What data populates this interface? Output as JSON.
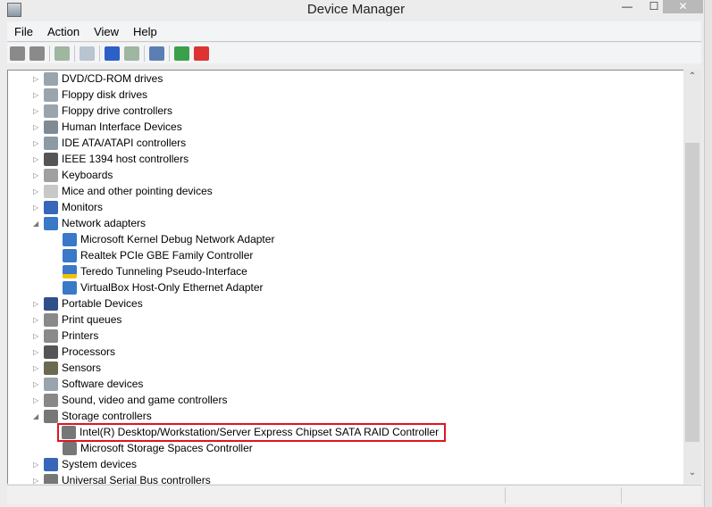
{
  "window": {
    "title": "Device Manager",
    "minimize": "—",
    "maximize": "☐",
    "close": "✕"
  },
  "menu": [
    "File",
    "Action",
    "View",
    "Help"
  ],
  "toolbar": [
    {
      "name": "back-icon",
      "color": "#8a8a8a"
    },
    {
      "name": "forward-icon",
      "color": "#8a8a8a"
    },
    {
      "sep": true
    },
    {
      "name": "show-hide-console-tree-icon",
      "color": "#9fb6a0"
    },
    {
      "sep": true
    },
    {
      "name": "properties-icon",
      "color": "#b8c4d0"
    },
    {
      "sep": true
    },
    {
      "name": "help-icon",
      "color": "#2d5fc8"
    },
    {
      "name": "show-action-pane-icon",
      "color": "#9fb6a0"
    },
    {
      "sep": true
    },
    {
      "name": "scan-hardware-icon",
      "color": "#5b7fb3"
    },
    {
      "sep": true
    },
    {
      "name": "update-driver-icon",
      "color": "#3aa04a"
    },
    {
      "name": "uninstall-icon",
      "color": "#d33"
    }
  ],
  "tree": [
    {
      "label": "DVD/CD-ROM drives",
      "level": 0,
      "state": "collapsed",
      "icon": "#9aa4ad"
    },
    {
      "label": "Floppy disk drives",
      "level": 0,
      "state": "collapsed",
      "icon": "#9aa4ad"
    },
    {
      "label": "Floppy drive controllers",
      "level": 0,
      "state": "collapsed",
      "icon": "#9aa4ad"
    },
    {
      "label": "Human Interface Devices",
      "level": 0,
      "state": "collapsed",
      "icon": "#7f8a94"
    },
    {
      "label": "IDE ATA/ATAPI controllers",
      "level": 0,
      "state": "collapsed",
      "icon": "#8c9aa3"
    },
    {
      "label": "IEEE 1394 host controllers",
      "level": 0,
      "state": "collapsed",
      "icon": "#555"
    },
    {
      "label": "Keyboards",
      "level": 0,
      "state": "collapsed",
      "icon": "#a0a0a0"
    },
    {
      "label": "Mice and other pointing devices",
      "level": 0,
      "state": "collapsed",
      "icon": "#c8c8c8"
    },
    {
      "label": "Monitors",
      "level": 0,
      "state": "collapsed",
      "icon": "#3866b8"
    },
    {
      "label": "Network adapters",
      "level": 0,
      "state": "expanded",
      "icon": "#3a78c8"
    },
    {
      "label": "Microsoft Kernel Debug Network Adapter",
      "level": 1,
      "icon": "#3a78c8"
    },
    {
      "label": "Realtek PCIe GBE Family Controller",
      "level": 1,
      "icon": "#3a78c8"
    },
    {
      "label": "Teredo Tunneling Pseudo-Interface",
      "level": 1,
      "icon": "#3a78c8",
      "warning": true
    },
    {
      "label": "VirtualBox Host-Only Ethernet Adapter",
      "level": 1,
      "icon": "#3a78c8"
    },
    {
      "label": "Portable Devices",
      "level": 0,
      "state": "collapsed",
      "icon": "#2f4f8a"
    },
    {
      "label": "Print queues",
      "level": 0,
      "state": "collapsed",
      "icon": "#8a8a8a"
    },
    {
      "label": "Printers",
      "level": 0,
      "state": "collapsed",
      "icon": "#8a8a8a"
    },
    {
      "label": "Processors",
      "level": 0,
      "state": "collapsed",
      "icon": "#555"
    },
    {
      "label": "Sensors",
      "level": 0,
      "state": "collapsed",
      "icon": "#6a6a50"
    },
    {
      "label": "Software devices",
      "level": 0,
      "state": "collapsed",
      "icon": "#9aa4ad"
    },
    {
      "label": "Sound, video and game controllers",
      "level": 0,
      "state": "collapsed",
      "icon": "#888"
    },
    {
      "label": "Storage controllers",
      "level": 0,
      "state": "expanded",
      "icon": "#777"
    },
    {
      "label": "Intel(R) Desktop/Workstation/Server Express Chipset SATA RAID Controller",
      "level": 1,
      "icon": "#777",
      "highlighted": true
    },
    {
      "label": "Microsoft Storage Spaces Controller",
      "level": 1,
      "icon": "#777"
    },
    {
      "label": "System devices",
      "level": 0,
      "state": "collapsed",
      "icon": "#3866b8"
    },
    {
      "label": "Universal Serial Bus controllers",
      "level": 0,
      "state": "collapsed",
      "icon": "#777"
    }
  ],
  "scrollbar": {
    "up": "⌃",
    "down": "⌄",
    "highlight_color": "#e0141e"
  }
}
